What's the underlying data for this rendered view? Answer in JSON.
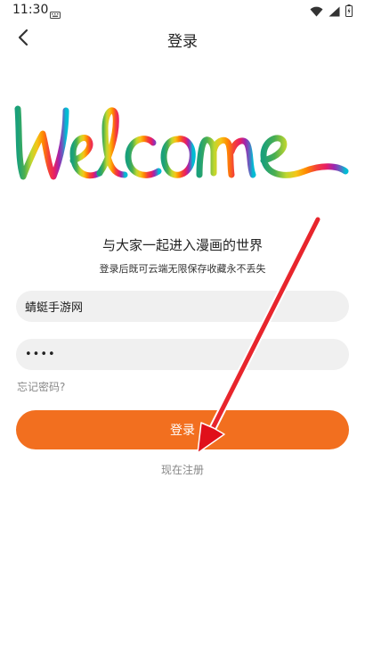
{
  "status": {
    "time": "11:30"
  },
  "nav": {
    "title": "登录"
  },
  "welcome": {
    "word": "Welcome",
    "colors": [
      "#1aa07a",
      "#8bc34a",
      "#f5c518",
      "#ff6a00",
      "#e91e63",
      "#9c27b0",
      "#3f51b5",
      "#00bcd4"
    ]
  },
  "intro": {
    "tagline": "与大家一起进入漫画的世界",
    "subline": "登录后既可云端无限保存收藏永不丢失"
  },
  "form": {
    "username_value": "蜻蜓手游网",
    "password_mask": "••••",
    "forgot_label": "忘记密码?",
    "login_label": "登录",
    "register_label": "现在注册"
  },
  "theme": {
    "accent": "#f26f1f",
    "field_bg": "#f0f0f0",
    "annotation_arrow": "#e0101a"
  }
}
